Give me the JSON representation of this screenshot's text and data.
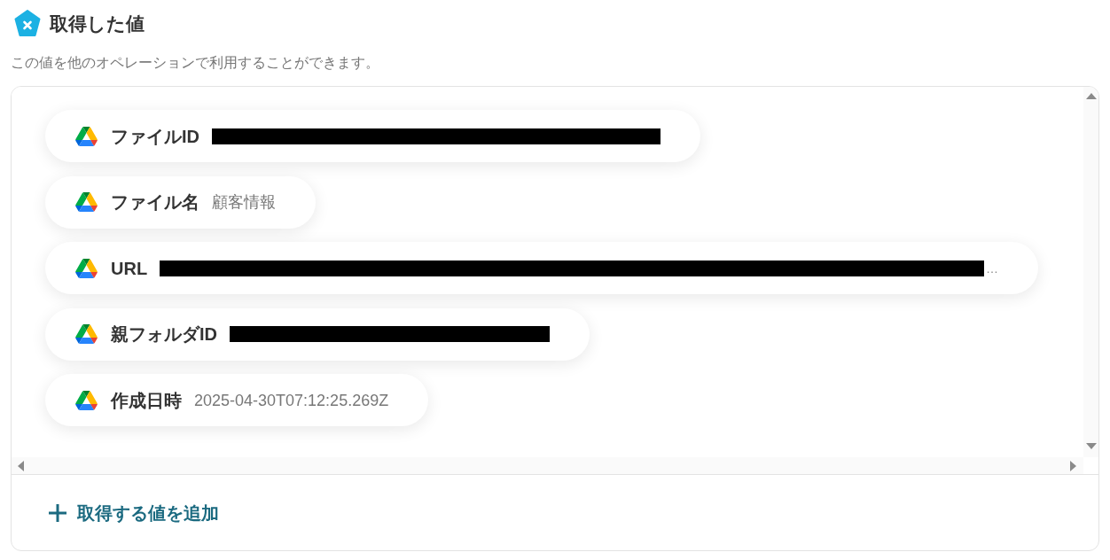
{
  "header": {
    "title": "取得した値",
    "description": "この値を他のオペレーションで利用することができます。"
  },
  "values": [
    {
      "label": "ファイルID",
      "kind": "redacted"
    },
    {
      "label": "ファイル名",
      "kind": "text",
      "value": "顧客情報"
    },
    {
      "label": "URL",
      "kind": "redacted",
      "overflow": "…"
    },
    {
      "label": "親フォルダID",
      "kind": "redacted"
    },
    {
      "label": "作成日時",
      "kind": "text",
      "value": "2025-04-30T07:12:25.269Z"
    }
  ],
  "add_button": {
    "label": "取得する値を追加"
  }
}
